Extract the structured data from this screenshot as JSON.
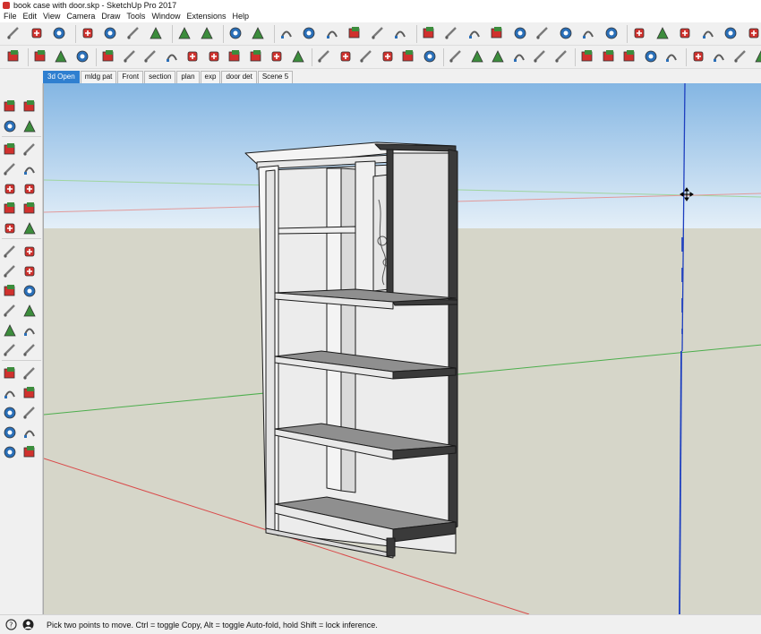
{
  "window": {
    "title": "book case with door.skp - SketchUp Pro 2017"
  },
  "menu": {
    "items": [
      "File",
      "Edit",
      "View",
      "Camera",
      "Draw",
      "Tools",
      "Window",
      "Extensions",
      "Help"
    ]
  },
  "toolbar1": {
    "icons": [
      "get-models-icon",
      "open-icon",
      "save-icon",
      "cut-icon",
      "copy-icon",
      "paste-icon",
      "erase-icon",
      "undo-icon",
      "redo-icon",
      "print-icon",
      "model-info-icon",
      "iso-view-icon",
      "top-view-icon",
      "front-view-icon",
      "right-view-icon",
      "back-view-icon",
      "left-view-icon",
      "orbit-icon",
      "pan-icon",
      "zoom-icon",
      "zoom-window-icon",
      "zoom-extents-icon",
      "previous-view-icon",
      "position-camera-icon",
      "look-around-icon",
      "walk-icon",
      "xray-icon",
      "back-edges-icon",
      "wireframe-icon",
      "hidden-line-icon",
      "shaded-icon",
      "shaded-textures-icon",
      "geo-location-icon"
    ]
  },
  "toolbar2": {
    "icons": [
      "select-icon",
      "make-component-icon",
      "eraser-icon",
      "paint-bucket-icon",
      "line-icon",
      "freehand-icon",
      "rectangle-icon",
      "rotated-rectangle-icon",
      "circle-icon",
      "polygon-icon",
      "arc-icon",
      "two-point-arc-icon",
      "three-point-arc-icon",
      "pie-icon",
      "move-icon",
      "push-pull-icon",
      "rotate-icon",
      "follow-me-icon",
      "scale-icon",
      "offset-icon",
      "tape-measure-icon",
      "dimension-icon",
      "protractor-icon",
      "text-icon",
      "axes-icon",
      "3d-text-icon",
      "section-plane-icon",
      "sandbox-from-contours-icon",
      "sandbox-scratch-icon",
      "smoove-icon",
      "stamp-icon",
      "drape-icon",
      "add-detail-icon",
      "flip-edge-icon",
      "section-display-icon"
    ]
  },
  "scenes": {
    "tabs": [
      "3d Open",
      "mldg pat",
      "Front",
      "section",
      "plan",
      "exp",
      "door det",
      "Scene 5"
    ],
    "active": 0
  },
  "left_palette": {
    "icons": [
      "select-icon",
      "make-component-icon",
      "paint-bucket-icon",
      "eraser-icon",
      "line-icon",
      "freehand-icon",
      "rectangle-icon",
      "rotated-rectangle-icon",
      "circle-icon",
      "polygon-icon",
      "arc-icon",
      "two-point-arc-icon",
      "three-point-arc-icon",
      "pie-icon",
      "move-icon",
      "push-pull-icon",
      "rotate-icon",
      "follow-me-icon",
      "scale-icon",
      "offset-icon",
      "tape-measure-icon",
      "dimension-icon",
      "protractor-icon",
      "text-icon",
      "axes-icon",
      "3d-text-icon",
      "orbit-icon",
      "pan-icon",
      "zoom-icon",
      "zoom-window-icon",
      "zoom-extents-icon",
      "previous-view-icon",
      "position-camera-icon",
      "look-around-icon",
      "walk-icon",
      "section-plane-icon"
    ]
  },
  "status": {
    "text": "Pick two points to move.  Ctrl = toggle Copy, Alt = toggle Auto-fold, hold Shift = lock inference."
  },
  "colors": {
    "sky_top": "#84b6e3",
    "sky_bottom": "#e4eff8",
    "ground": "#d6d6c9",
    "accent": "#2f7fd0",
    "red_axis": "#d94a4a",
    "green_axis": "#4cae4c",
    "blue_axis": "#1e3fbf",
    "shelf_top": "#8f8f8f"
  }
}
